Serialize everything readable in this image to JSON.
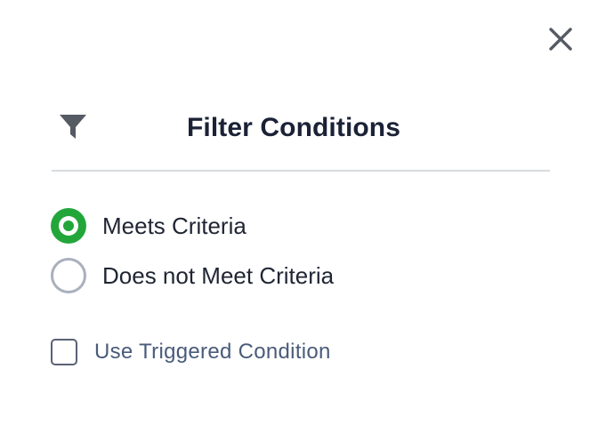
{
  "dialog": {
    "title": "Filter Conditions",
    "header_icon": "filter-funnel-icon",
    "close_icon": "close-icon"
  },
  "criteria_options": [
    {
      "label": "Meets Criteria",
      "selected": true
    },
    {
      "label": "Does not Meet Criteria",
      "selected": false
    }
  ],
  "triggered_condition": {
    "label": "Use Triggered Condition",
    "checked": false
  },
  "colors": {
    "accent": "#22a63a",
    "title_text": "#1b2236",
    "label_text": "#1f2533",
    "muted_text": "#4a5b7a",
    "radio_border": "#a9b0bd",
    "icon": "#555a63",
    "divider": "#d8dbe0"
  }
}
